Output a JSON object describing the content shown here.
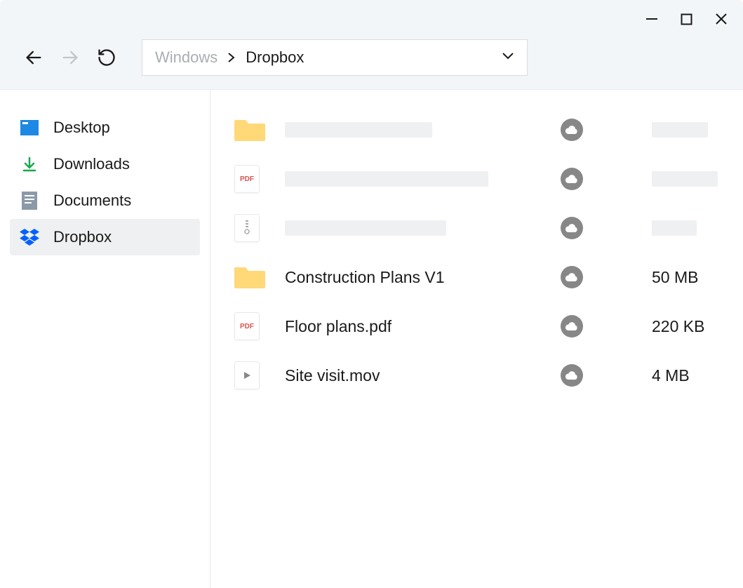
{
  "breadcrumb": {
    "parent": "Windows",
    "current": "Dropbox"
  },
  "sidebar": {
    "items": [
      {
        "label": "Desktop"
      },
      {
        "label": "Downloads"
      },
      {
        "label": "Documents"
      },
      {
        "label": "Dropbox"
      }
    ]
  },
  "files": [
    {
      "name": "Construction Plans V1",
      "size": "50 MB"
    },
    {
      "name": "Floor plans.pdf",
      "size": "220 KB"
    },
    {
      "name": "Site visit.mov",
      "size": "4 MB"
    }
  ]
}
